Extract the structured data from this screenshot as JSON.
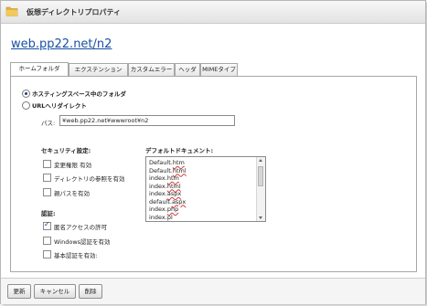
{
  "window": {
    "title": "仮想ディレクトリプロパティ",
    "folder_icon": "folder-icon"
  },
  "breadcrumb": "web.pp22.net/n2",
  "tabs": [
    {
      "label": "ホームフォルダ",
      "active": true
    },
    {
      "label": "エクステンション",
      "active": false
    },
    {
      "label": "カスタムエラー",
      "active": false
    },
    {
      "label": "ヘッダ",
      "active": false
    },
    {
      "label": "MIMEタイプ",
      "active": false
    }
  ],
  "home": {
    "radio_hosting": {
      "label": "ホスティングスペース中のフォルダ",
      "selected": true
    },
    "radio_redirect": {
      "label": "URLへリダイレクト",
      "selected": false
    },
    "path_label": "パス:",
    "path_value": "¥web.pp22.net¥wwwroot¥n2"
  },
  "security": {
    "heading": "セキュリティ設定:",
    "items": [
      {
        "label": "変更権限 有効",
        "checked": false
      },
      {
        "label": "ディレクトリの参照を有効",
        "checked": false
      },
      {
        "label": "親パスを有効",
        "checked": false
      }
    ]
  },
  "auth": {
    "heading": "認証:",
    "items": [
      {
        "label": "匿名アクセスの許可",
        "checked": true
      },
      {
        "label": "Windows認証を有効",
        "checked": false
      },
      {
        "label": "基本認証を有効:",
        "checked": false
      }
    ]
  },
  "default_docs": {
    "heading": "デフォルトドキュメント:",
    "items": [
      "Default.htm",
      "Default.html",
      "index.htm",
      "index.html",
      "index.aspx",
      "default.aspx",
      "index.php",
      "index.pl"
    ]
  },
  "footer": {
    "update": "更新",
    "cancel": "キャンセル",
    "delete": "削除"
  }
}
